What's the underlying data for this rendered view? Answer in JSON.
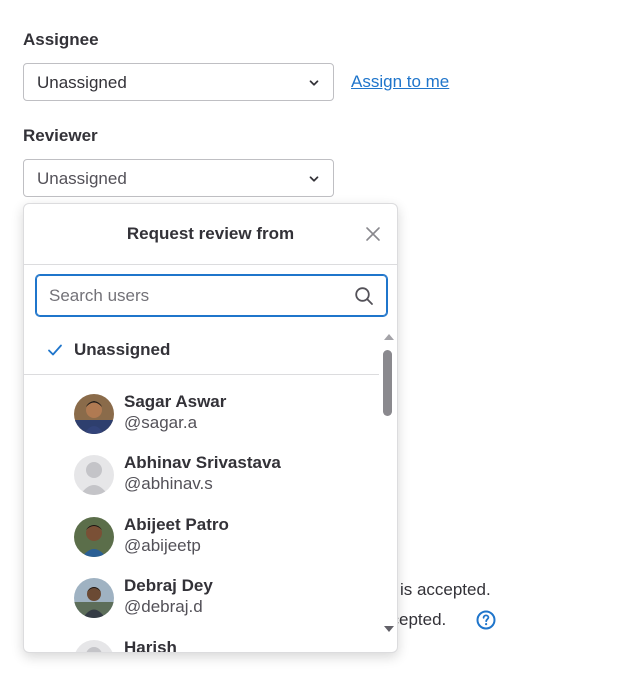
{
  "assignee": {
    "label": "Assignee",
    "value": "Unassigned",
    "assign_to_me": "Assign to me"
  },
  "reviewer": {
    "label": "Reviewer",
    "value": "Unassigned"
  },
  "background": {
    "line1_fragment": "st is accepted.",
    "line2_fragment": "ccepted."
  },
  "dropdown": {
    "title": "Request review from",
    "search_placeholder": "Search users",
    "unassigned_label": "Unassigned",
    "users": [
      {
        "name": "Sagar Aswar",
        "handle": "@sagar.a"
      },
      {
        "name": "Abhinav Srivastava",
        "handle": "@abhinav.s"
      },
      {
        "name": "Abijeet Patro",
        "handle": "@abijeetp"
      },
      {
        "name": "Debraj Dey",
        "handle": "@debraj.d"
      },
      {
        "name": "Harish",
        "handle": ""
      }
    ]
  },
  "colors": {
    "link": "#1f75cb",
    "focus": "#1f75cb",
    "text": "#333238"
  }
}
